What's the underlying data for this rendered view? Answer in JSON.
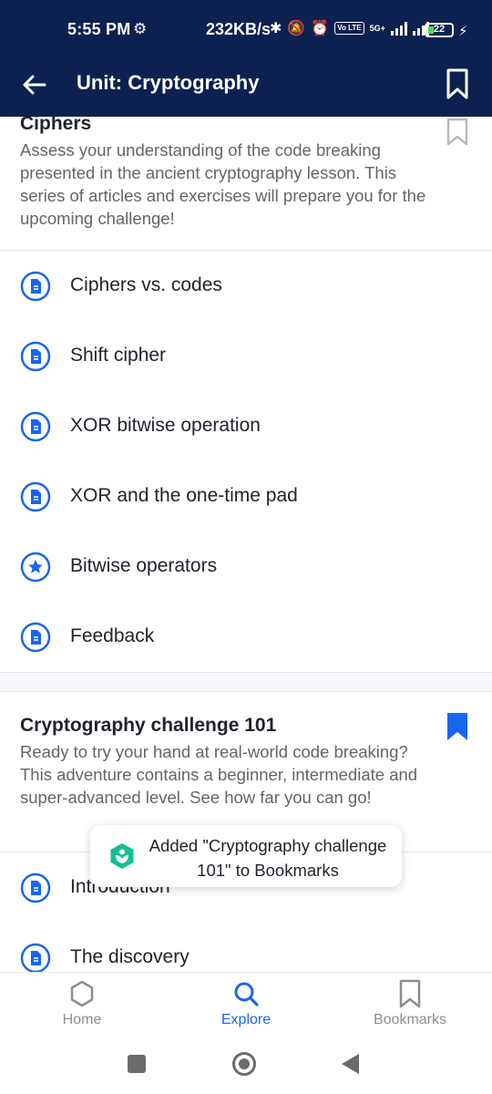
{
  "status_bar": {
    "time": "5:55 PM",
    "network_speed": "232KB/s",
    "network_type": "5G+",
    "volte": "Vo LTE",
    "battery": "22"
  },
  "app_bar": {
    "title": "Unit: Cryptography"
  },
  "sections": [
    {
      "title": "Ciphers",
      "description": "Assess your understanding of the code breaking presented in the ancient cryptography lesson. This series of articles and exercises will prepare you for the upcoming challenge!",
      "bookmarked": false,
      "items": [
        {
          "label": "Ciphers vs. codes",
          "icon": "article-icon"
        },
        {
          "label": "Shift cipher",
          "icon": "article-icon"
        },
        {
          "label": "XOR bitwise operation",
          "icon": "article-icon"
        },
        {
          "label": "XOR and the one-time pad",
          "icon": "article-icon"
        },
        {
          "label": "Bitwise operators",
          "icon": "star-icon"
        },
        {
          "label": "Feedback",
          "icon": "article-icon"
        }
      ]
    },
    {
      "title": "Cryptography challenge 101",
      "description": "Ready to try your hand at real-world code breaking? This adventure contains a beginner, intermediate and super-advanced level. See how far you can go!",
      "bookmarked": true,
      "items": [
        {
          "label": "Introduction",
          "icon": "article-icon"
        },
        {
          "label": "The discovery",
          "icon": "article-icon"
        }
      ]
    }
  ],
  "toast": {
    "message": "Added \"Cryptography challenge 101\" to Bookmarks"
  },
  "bottom_nav": [
    {
      "label": "Home",
      "icon": "hexagon-icon",
      "active": false
    },
    {
      "label": "Explore",
      "icon": "search-icon",
      "active": true
    },
    {
      "label": "Bookmarks",
      "icon": "bookmark-icon",
      "active": false
    }
  ],
  "colors": {
    "header_bg": "#0b2150",
    "accent": "#1865f2",
    "text": "#21242c",
    "muted": "#626569",
    "toast_logo": "#14bf96"
  }
}
